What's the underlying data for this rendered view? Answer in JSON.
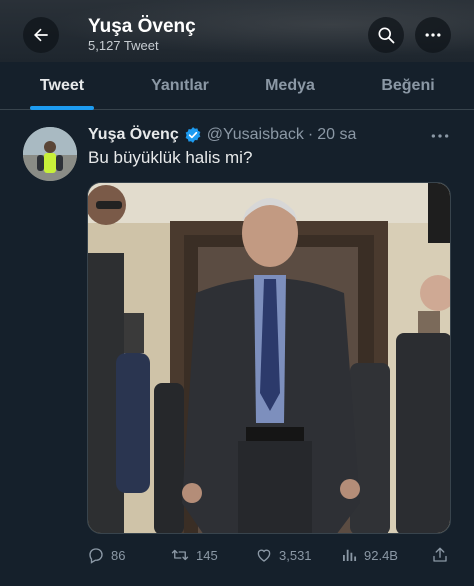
{
  "header": {
    "title": "Yuşa Övenç",
    "tweet_count": "5,127 Tweet"
  },
  "tabs": [
    {
      "label": "Tweet",
      "active": true
    },
    {
      "label": "Yanıtlar",
      "active": false
    },
    {
      "label": "Medya",
      "active": false
    },
    {
      "label": "Beğeni",
      "active": false
    }
  ],
  "tweet": {
    "author_name": "Yuşa Övenç",
    "handle": "@Yusaisback",
    "separator": "·",
    "time": "20 sa",
    "text": "Bu büyüklük halis mi?",
    "replies": "86",
    "retweets": "145",
    "likes": "3,531",
    "views": "92.4B"
  },
  "colors": {
    "background": "#15202b",
    "accent": "#1d9bf0",
    "muted_text": "#8b98a5"
  },
  "icons": [
    "back-arrow-icon",
    "search-icon",
    "more-icon",
    "verified-badge-icon",
    "reply-icon",
    "retweet-icon",
    "like-icon",
    "views-icon",
    "share-icon"
  ]
}
